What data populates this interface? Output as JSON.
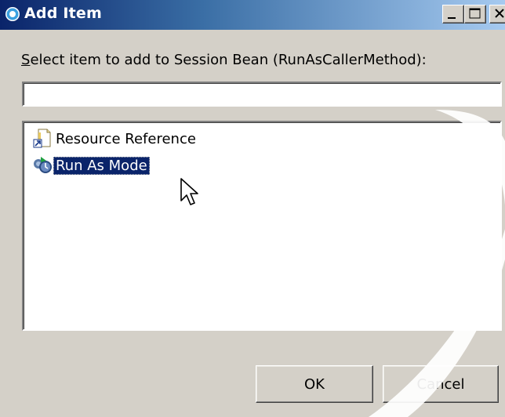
{
  "window": {
    "title": "Add Item",
    "title_icon": "eclipse-circle-icon",
    "controls": {
      "minimize": "minimize-icon",
      "maximize": "maximize-icon",
      "close": "close-icon"
    }
  },
  "prompt": {
    "label": "Select item to add to Session Bean (RunAsCallerMethod):",
    "mnemonic": "S"
  },
  "search": {
    "value": "",
    "placeholder": ""
  },
  "tree": {
    "items": [
      {
        "label": "Resource Reference",
        "icon": "resource-reference-icon",
        "selected": false
      },
      {
        "label": "Run As Mode",
        "icon": "run-as-mode-icon",
        "selected": true
      }
    ]
  },
  "buttons": {
    "ok_label": "OK",
    "cancel_label": "Cancel"
  },
  "colors": {
    "title_bar": "#0a246a",
    "selection": "#0a246a",
    "face": "#d4d0c8"
  }
}
